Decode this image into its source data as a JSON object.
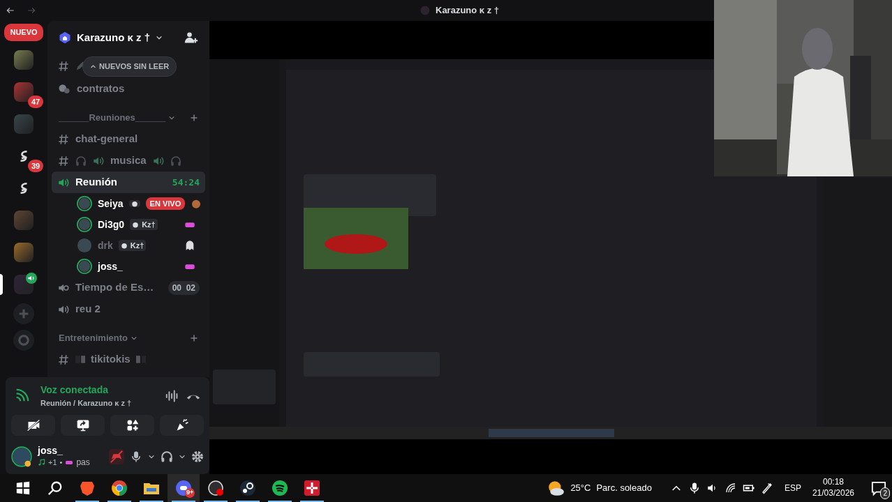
{
  "window": {
    "title": "Karazuno ᴋ ᴢ †"
  },
  "server_rail": {
    "new_badge": "NUEVO",
    "servers": [
      {
        "kind": "avatar",
        "selected": false
      },
      {
        "kind": "avatar",
        "selected": false,
        "badge": "47"
      },
      {
        "kind": "avatar",
        "selected": false
      },
      {
        "kind": "logo",
        "selected": false,
        "badge": "39"
      },
      {
        "kind": "logo",
        "selected": false
      },
      {
        "kind": "avatar",
        "selected": false
      },
      {
        "kind": "avatar",
        "selected": false
      },
      {
        "kind": "avatar",
        "selected": true
      }
    ]
  },
  "server": {
    "name": "Karazuno ᴋ ᴢ †"
  },
  "unread_pill": "NUEVOS SIN LEER",
  "channels": [
    {
      "kind": "text"
    },
    {
      "kind": "forum",
      "name": "contratos"
    },
    {
      "kind": "category",
      "name": "______Reuniones______"
    },
    {
      "kind": "text",
      "name": "chat-general"
    },
    {
      "kind": "music",
      "name": "musica"
    },
    {
      "kind": "voice",
      "name": "Reunión",
      "selected": true,
      "timer": "54:24",
      "members": [
        {
          "name": "Seiya",
          "speaking": true,
          "live": "EN VIVO"
        },
        {
          "name": "Di3g0",
          "speaking": true,
          "tag": "Kz†"
        },
        {
          "name": "drk",
          "speaking": false,
          "tag": "Kz†"
        },
        {
          "name": "joss_",
          "speaking": true
        }
      ]
    },
    {
      "kind": "stage",
      "name": "Tiempo de Es…",
      "selected": false,
      "timer_parts": [
        "00",
        "02"
      ]
    },
    {
      "kind": "voice",
      "name": "reu 2",
      "selected": false
    },
    {
      "kind": "category",
      "name": "Entretenimiento"
    },
    {
      "kind": "text",
      "name": "tikitokis"
    }
  ],
  "voice_panel": {
    "status": "Voz conectada",
    "location": "Reunión / Karazuno ᴋ ᴢ †"
  },
  "user": {
    "name": "joss_",
    "activity_count": "+1",
    "separator": "•",
    "status_text": "pas"
  },
  "taskbar": {
    "discord_badge": "9+",
    "temperature": "25°C",
    "weather": "Parc. soleado",
    "language": "ESP",
    "time": "00:18",
    "date": "21/03/2026",
    "notifications": "2"
  }
}
